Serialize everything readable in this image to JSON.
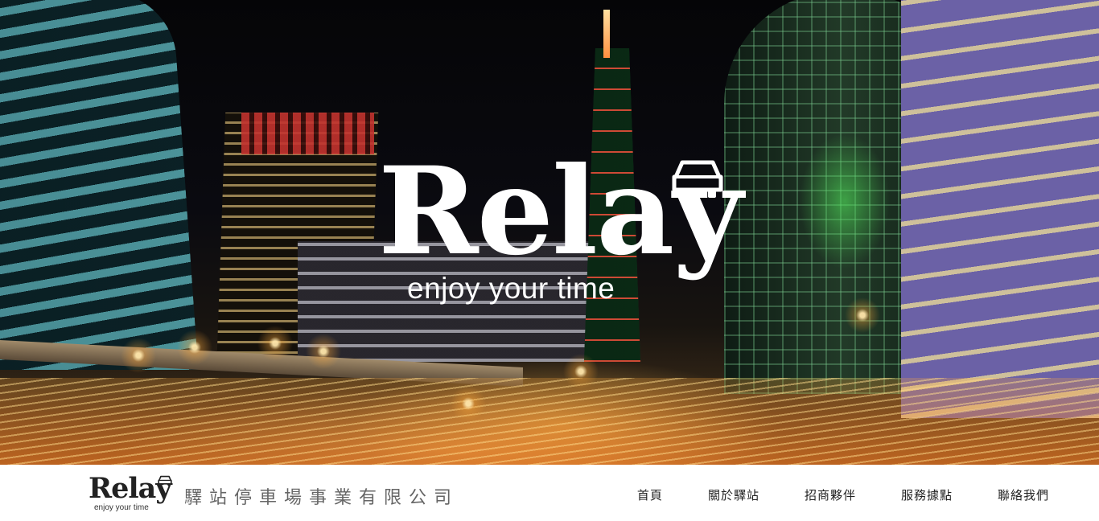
{
  "hero": {
    "logo_word": "Relay",
    "tagline": "enjoy your time",
    "logo_icon": "car-icon"
  },
  "header": {
    "brand_word": "Relay",
    "brand_tagline": "enjoy your time",
    "company_name": "驛站停車場事業有限公司"
  },
  "nav": {
    "items": [
      {
        "label": "首頁"
      },
      {
        "label": "關於驛站"
      },
      {
        "label": "招商夥伴"
      },
      {
        "label": "服務據點"
      },
      {
        "label": "聯絡我們"
      }
    ]
  },
  "colors": {
    "nav_text": "#222222",
    "company_text": "#666666",
    "logo_white": "#ffffff"
  }
}
